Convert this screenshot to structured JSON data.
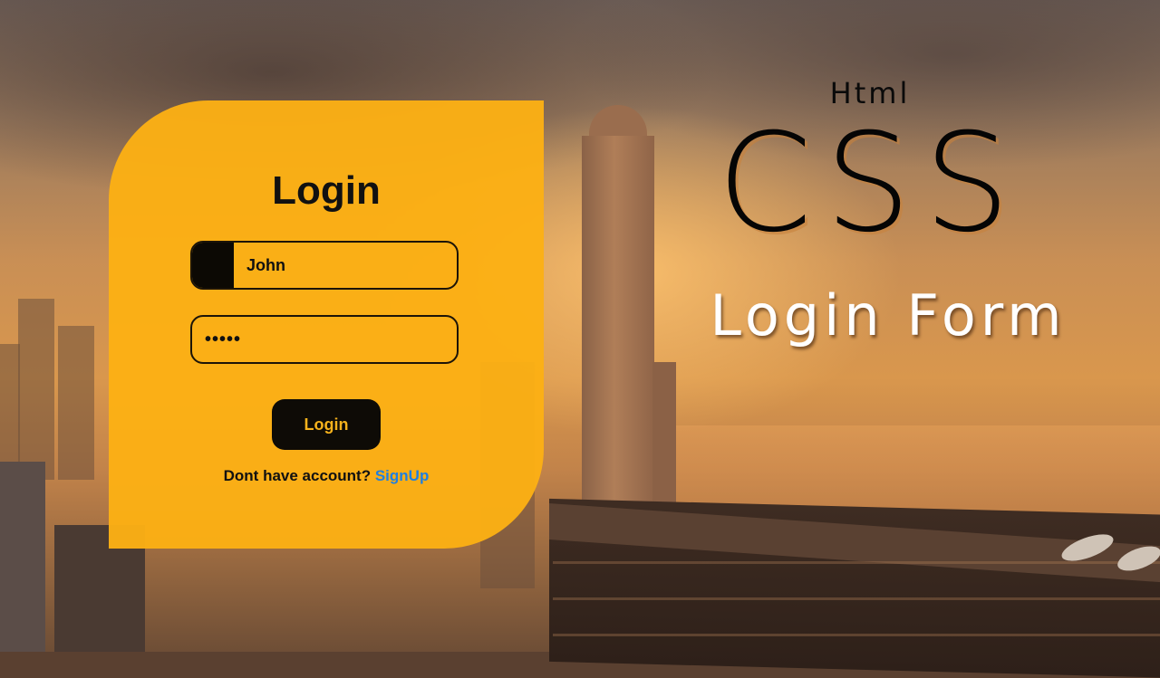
{
  "login_card": {
    "title": "Login",
    "username_value": "John",
    "password_value": "•••••",
    "login_button": "Login",
    "signup_prompt": "Dont have account?",
    "signup_link": "SignUp"
  },
  "headline": {
    "line1": "Html",
    "line2": "CSS",
    "line3": "Login Form"
  },
  "colors": {
    "card": "#FCB014",
    "button": "#0E0B06",
    "button_text": "#F6B21C",
    "link": "#1F7FE0",
    "subtitle": "#FFFFFF"
  },
  "icons": [
    "satellite-dish-icon"
  ]
}
